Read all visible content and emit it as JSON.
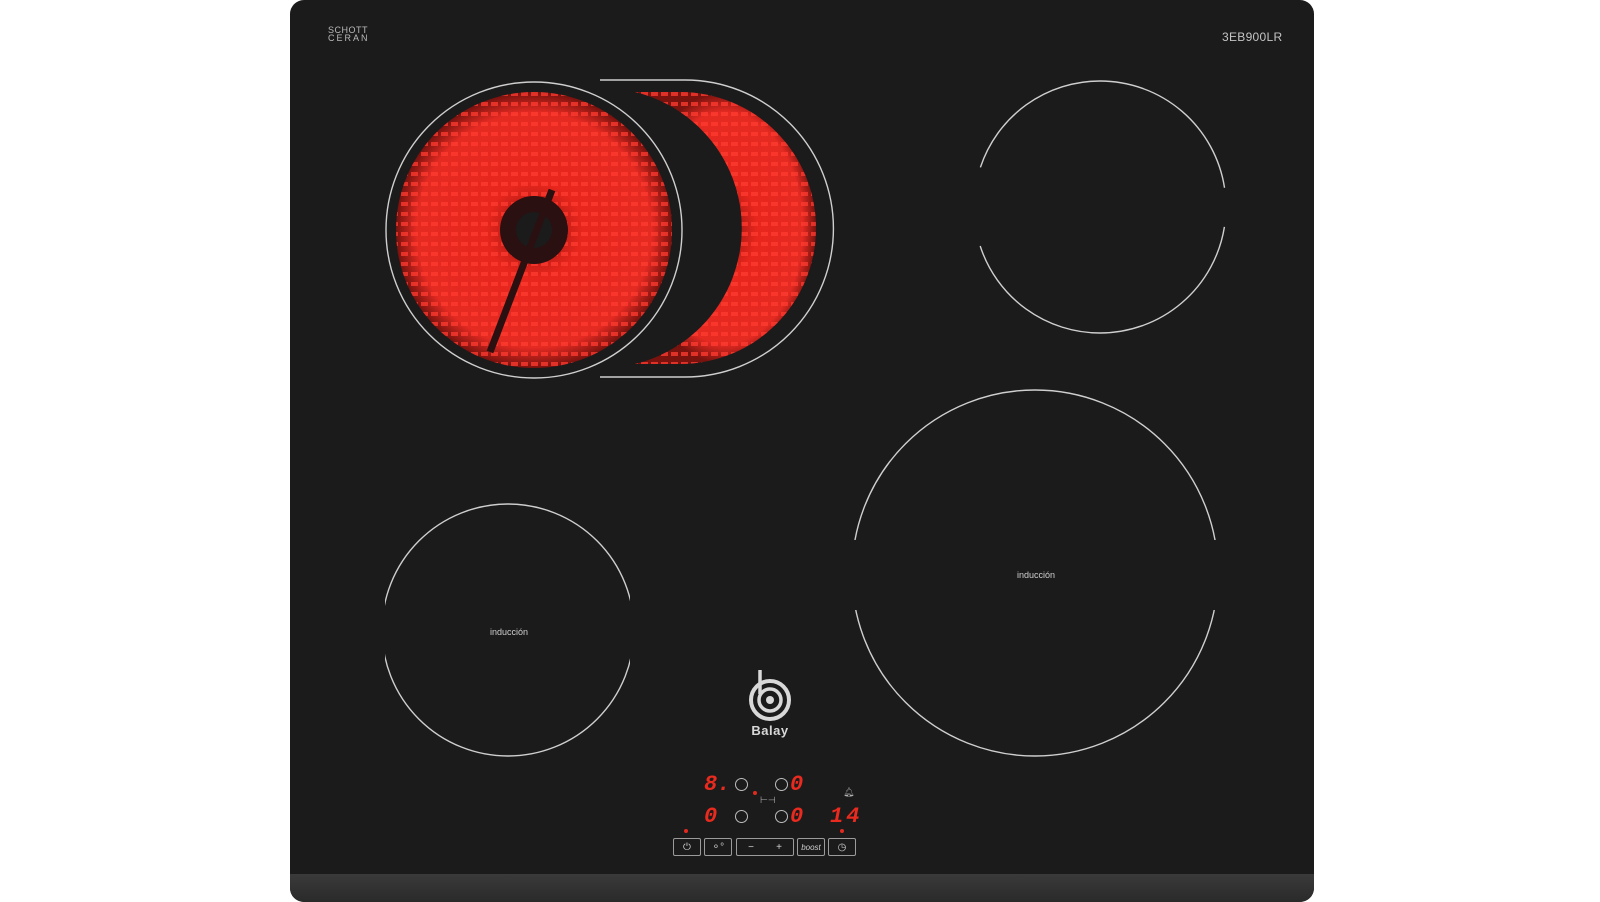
{
  "brand": {
    "glass_top": "SCHOTT",
    "glass_bottom": "CERAN",
    "logo": "Balay"
  },
  "model": "3EB900LR",
  "zones": {
    "left_induction_label": "inducción",
    "right_induction_label": "inducción"
  },
  "display": {
    "top_left_digit": "8.",
    "top_mid_digit": "0",
    "bottom_left_digit": "0",
    "bottom_mid_digit": "0",
    "timer_digits": "14"
  },
  "controls": {
    "power_icon": "power-icon",
    "zone_select_icon": "zone-select-icon",
    "minus": "−",
    "plus": "+",
    "boost": "boost",
    "timer_icon": "clock-icon"
  },
  "colors": {
    "glass": "#1c1b1b",
    "heat": "#e8261d",
    "ring": "#cfcfcf",
    "display": "#e82a1f"
  }
}
